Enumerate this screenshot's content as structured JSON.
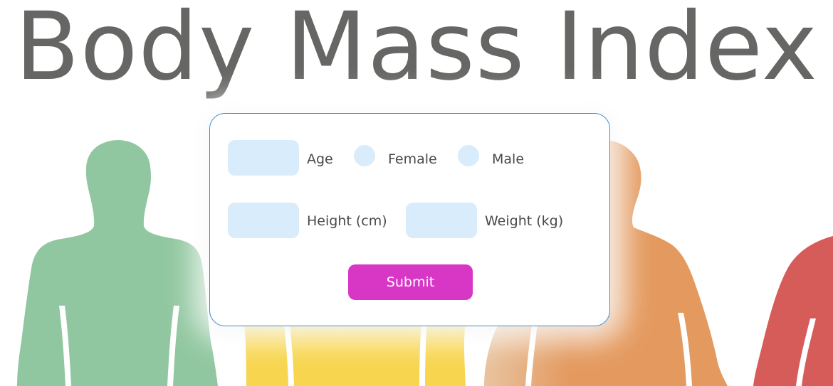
{
  "page": {
    "title": "Body Mass Index"
  },
  "form": {
    "age": {
      "label": "Age",
      "value": ""
    },
    "gender_options": [
      {
        "label": "Female",
        "selected": false
      },
      {
        "label": "Male",
        "selected": false
      }
    ],
    "height": {
      "label": "Height (cm)",
      "value": ""
    },
    "weight": {
      "label": "Weight (kg)",
      "value": ""
    },
    "submit_label": "Submit"
  },
  "colors": {
    "title": "#666664",
    "card_border": "#2f8fd8",
    "input_bg": "#d9ecfb",
    "submit_bg": "#d837c6",
    "figure_underweight": "#91c7a0",
    "figure_normal": "#f7d54e",
    "figure_overweight": "#e49a5f",
    "figure_obese": "#d65c5a"
  }
}
